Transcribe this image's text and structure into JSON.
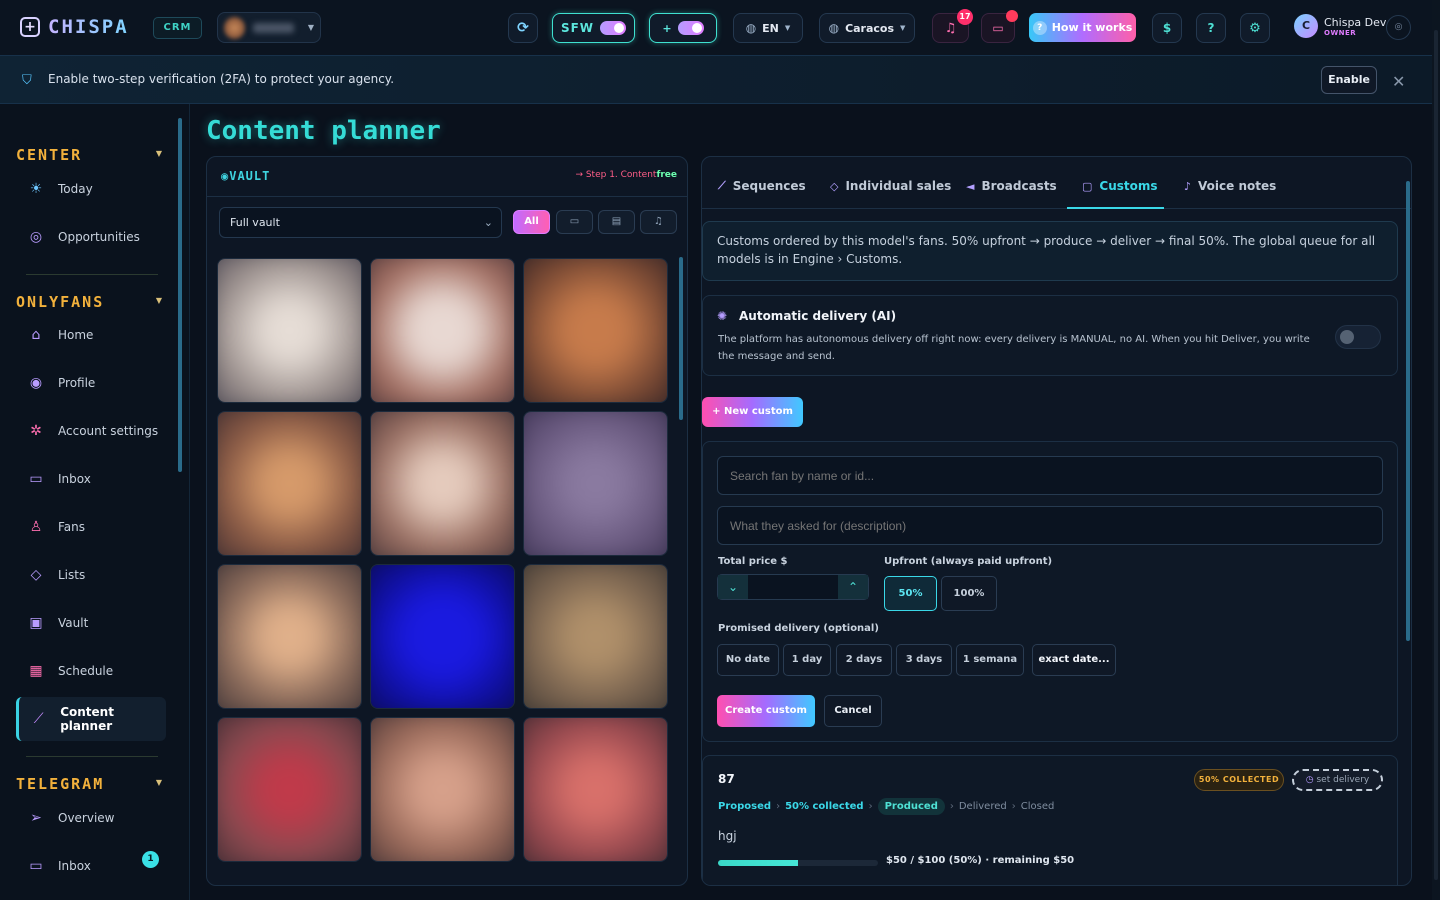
{
  "topbar": {
    "logo": "CHISPA",
    "crm_badge": "CRM",
    "sfw_label": "SFW",
    "plus_label": "+",
    "language": "EN",
    "timezone": "Caracos",
    "notification_count": "17",
    "how_it_works": "How it works",
    "dollar_label": "$",
    "help_label": "?",
    "user_initial": "C",
    "user_name": "Chispa Dev",
    "user_role": "OWNER"
  },
  "banner": {
    "text": "Enable two-step verification (2FA) to protect your agency.",
    "enable_label": "Enable",
    "close_label": "✕"
  },
  "sidebar": {
    "center": {
      "title": "CENTER",
      "items": [
        {
          "label": "Today",
          "icon": "sunrise-icon"
        },
        {
          "label": "Opportunities",
          "icon": "target-icon"
        }
      ]
    },
    "onlyfans": {
      "title": "ONLYFANS",
      "items": [
        {
          "label": "Home",
          "icon": "home-icon"
        },
        {
          "label": "Profile",
          "icon": "user-circle-icon"
        },
        {
          "label": "Account settings",
          "icon": "settings-icon"
        },
        {
          "label": "Inbox",
          "icon": "chat-icon"
        },
        {
          "label": "Fans",
          "icon": "person-icon"
        },
        {
          "label": "Lists",
          "icon": "tag-icon"
        },
        {
          "label": "Vault",
          "icon": "vault-icon"
        },
        {
          "label": "Schedule",
          "icon": "calendar-icon"
        },
        {
          "label": "Content planner",
          "icon": "steps-icon"
        }
      ]
    },
    "telegram": {
      "title": "TELEGRAM",
      "items": [
        {
          "label": "Overview",
          "icon": "send-icon"
        },
        {
          "label": "Inbox",
          "icon": "chat-icon",
          "badge": "1"
        }
      ]
    }
  },
  "page": {
    "title": "Content planner"
  },
  "vault": {
    "title": "VAULT",
    "step_prefix": "→ Step 1. Content",
    "step_suffix": "free",
    "select_value": "Full vault",
    "filters": [
      "All",
      "▭",
      "▤",
      "♫"
    ]
  },
  "tabs": [
    {
      "label": "Sequences",
      "icon": "steps-icon"
    },
    {
      "label": "Individual sales",
      "icon": "tag-icon"
    },
    {
      "label": "Broadcasts",
      "icon": "megaphone-icon"
    },
    {
      "label": "Customs",
      "icon": "box-icon",
      "active": true
    },
    {
      "label": "Voice notes",
      "icon": "mic-icon"
    }
  ],
  "customs": {
    "info": "Customs ordered by this model's fans. 50% upfront → produce → deliver → final 50%. The global queue for all models is in Engine › Customs.",
    "ai_title": "Automatic delivery (AI)",
    "ai_desc": "The platform has autonomous delivery off right now: every delivery is MANUAL, no AI. When you hit Deliver, you write the message and send.",
    "new_custom": "+ New custom",
    "form": {
      "search_placeholder": "Search fan by name or id...",
      "desc_placeholder": "What they asked for (description)",
      "price_label": "Total price $",
      "upfront_label": "Upfront (always paid upfront)",
      "upfront_options": [
        "50%",
        "100%"
      ],
      "delivery_label": "Promised delivery (optional)",
      "delivery_options": [
        "No date",
        "1 day",
        "2 days",
        "3 days",
        "1 semana",
        "exact date..."
      ],
      "create_label": "Create custom",
      "cancel_label": "Cancel"
    },
    "order": {
      "id": "87",
      "status_badge": "50% COLLECTED",
      "set_delivery": "set delivery",
      "stages": [
        "Proposed",
        "50% collected",
        "Produced",
        "Delivered",
        "Closed"
      ],
      "description": "hgj",
      "progress": 0.5,
      "amount_text": "$50 / $100 (50%) · remaining $50"
    }
  }
}
